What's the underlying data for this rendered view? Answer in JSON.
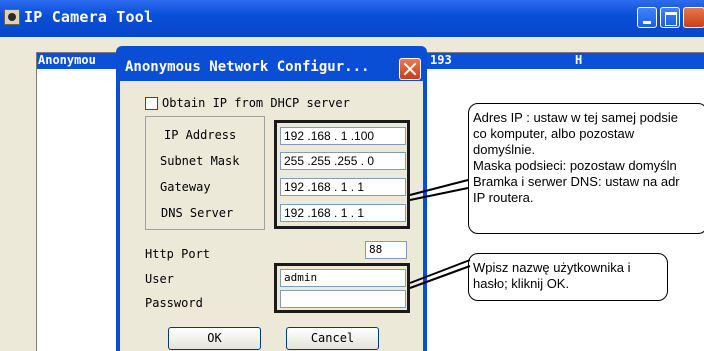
{
  "main_window": {
    "title": "IP Camera Tool",
    "list_columns": [
      "Anonymou",
      "193",
      "H"
    ],
    "colors": {
      "titlebar": "#0a4fd8",
      "window_bg": "#ece9d8"
    }
  },
  "dialog": {
    "title": "Anonymous Network Configur...",
    "dhcp_label": "Obtain IP from DHCP server",
    "dhcp_checked": false,
    "fields": [
      {
        "label": "IP Address",
        "value": "192 .168 . 1 .100"
      },
      {
        "label": "Subnet Mask",
        "value": "255 .255 .255 . 0"
      },
      {
        "label": "Gateway",
        "value": "192 .168 . 1 . 1"
      },
      {
        "label": "DNS Server",
        "value": "192 .168 . 1 . 1"
      }
    ],
    "http_port": {
      "label": "Http Port",
      "value": "88"
    },
    "user": {
      "label": "User",
      "value": "admin"
    },
    "password": {
      "label": "Password",
      "value": ""
    },
    "buttons": {
      "ok": "OK",
      "cancel": "Cancel"
    }
  },
  "callouts": {
    "network": [
      "Adres IP : ustaw w tej samej podsie",
      "co komputer, albo pozostaw",
      "domyślnie.",
      "Maska podsieci: pozostaw domyśln",
      "Bramka i serwer DNS: ustaw na adr",
      "IP routera."
    ],
    "login": [
      "Wpisz nazwę użytkownika i",
      "hasło; kliknij OK."
    ]
  }
}
